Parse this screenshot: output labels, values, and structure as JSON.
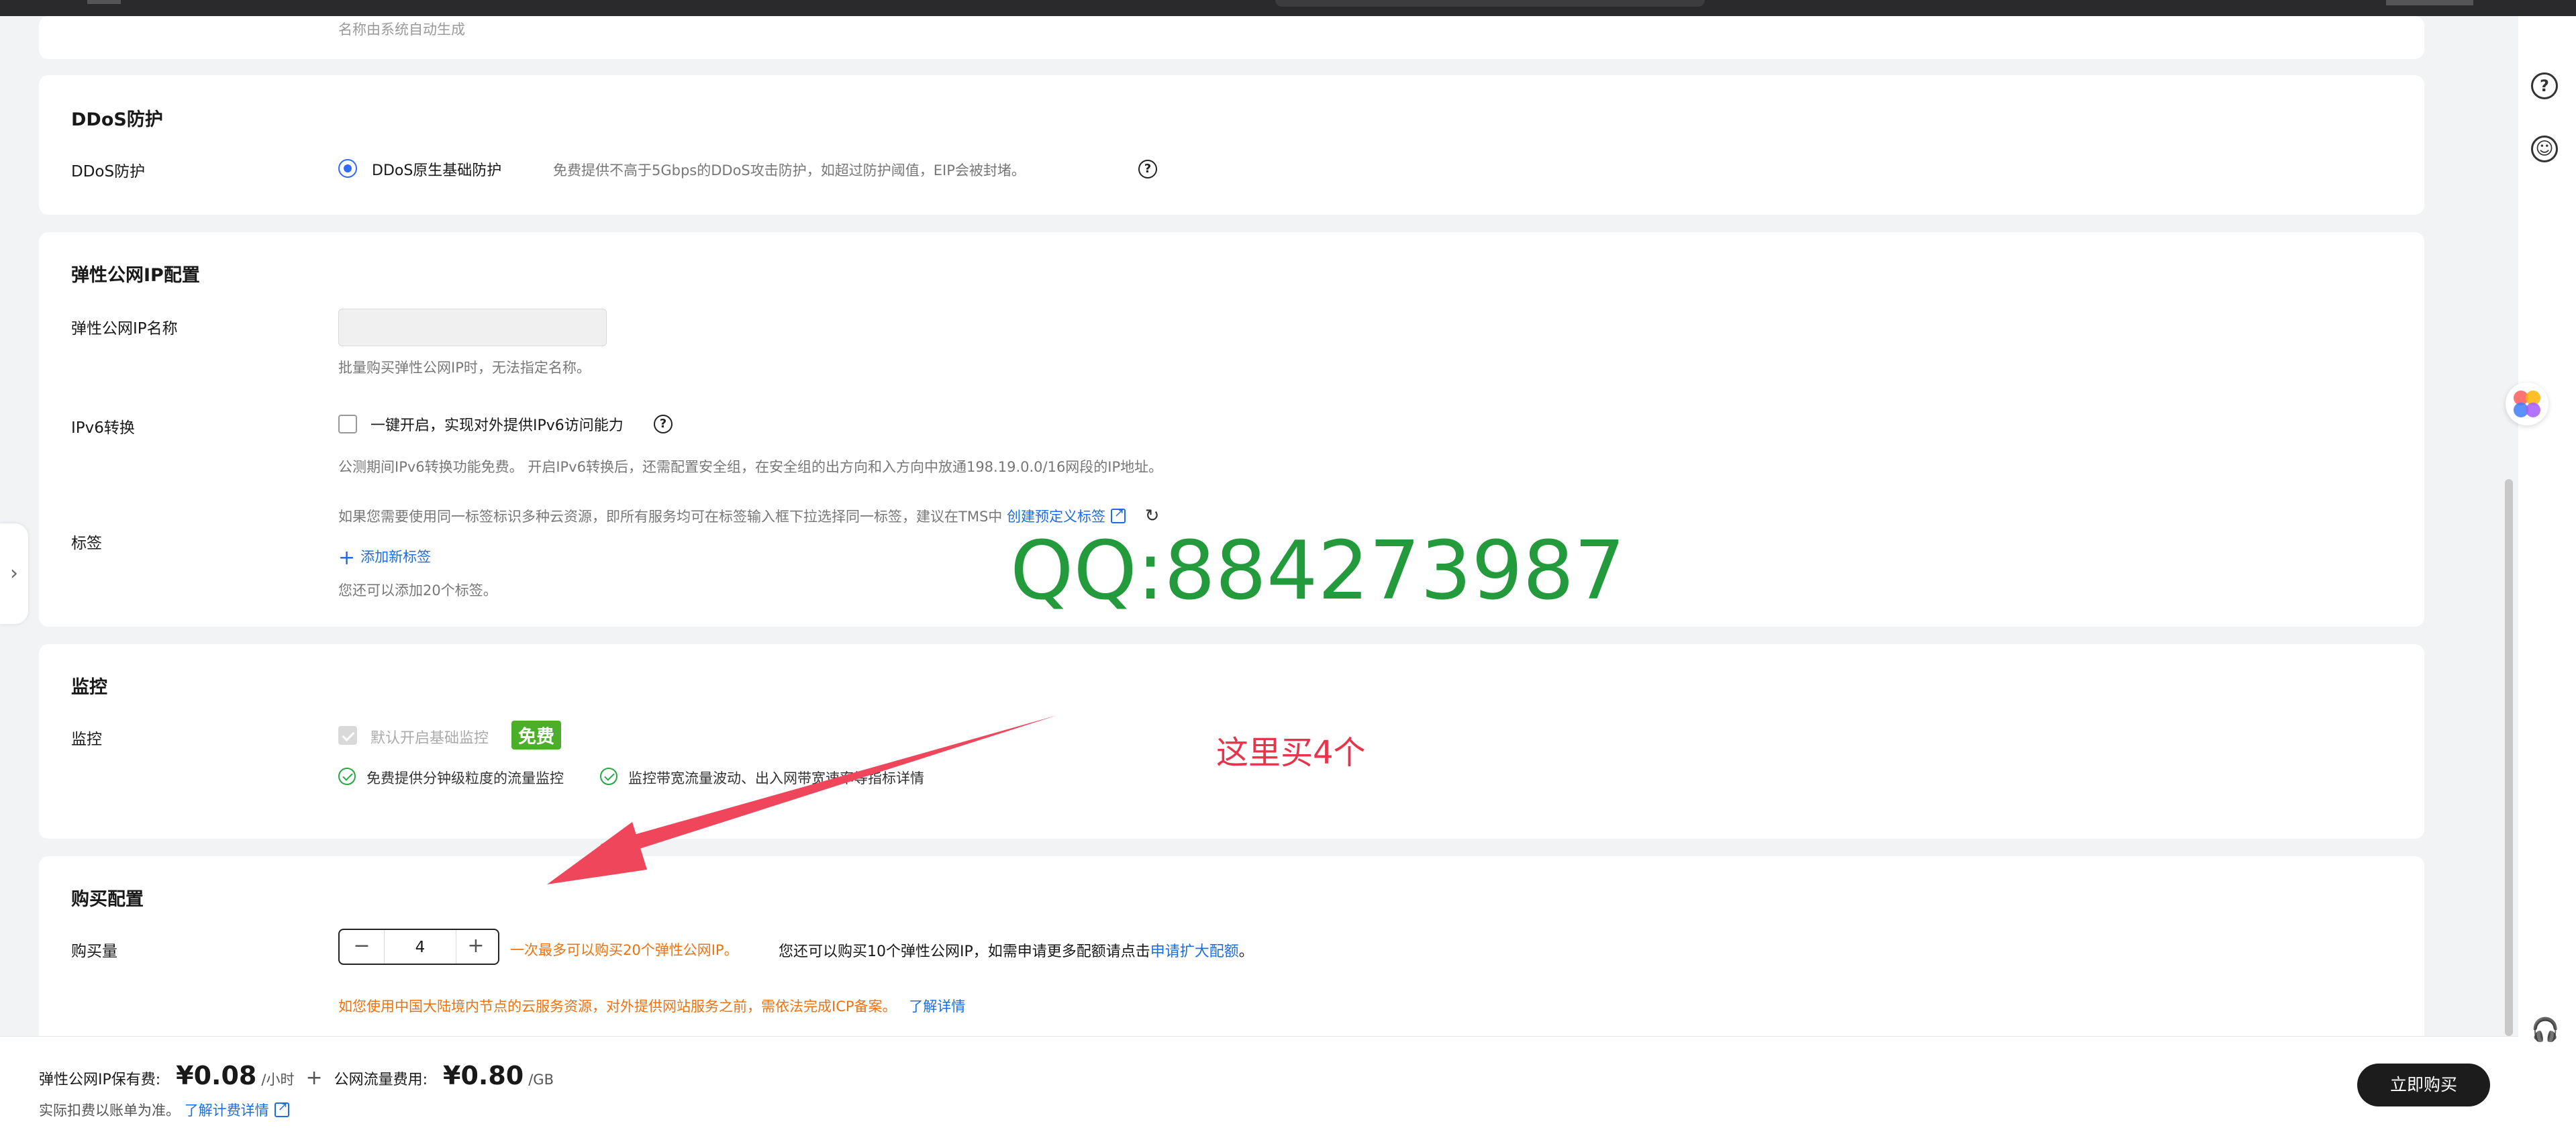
{
  "top_note": "名称由系统自动生成",
  "ddos": {
    "title": "DDoS防护",
    "label": "DDoS防护",
    "option": "DDoS原生基础防护",
    "desc": "免费提供不高于5Gbps的DDoS攻击防护，如超过防护阈值，EIP会被封堵。"
  },
  "eip": {
    "title": "弹性公网IP配置",
    "name_label": "弹性公网IP名称",
    "name_value": "",
    "name_hint": "批量购买弹性公网IP时，无法指定名称。",
    "ipv6_label": "IPv6转换",
    "ipv6_option": "一键开启，实现对外提供IPv6访问能力",
    "ipv6_hint": "公测期间IPv6转换功能免费。 开启IPv6转换后，还需配置安全组，在安全组的出方向和入方向中放通198.19.0.0/16网段的IP地址。",
    "tag_label": "标签",
    "tag_desc": "如果您需要使用同一标签标识多种云资源，即所有服务均可在标签输入框下拉选择同一标签，建议在TMS中",
    "tag_link": "创建预定义标签",
    "add_tag": "添加新标签",
    "tag_remaining": "您还可以添加20个标签。"
  },
  "monitor": {
    "title": "监控",
    "label": "监控",
    "option": "默认开启基础监控",
    "badge": "免费",
    "feature1": "免费提供分钟级粒度的流量监控",
    "feature2": "监控带宽流量波动、出入网带宽速率等指标详情"
  },
  "purchase": {
    "title": "购买配置",
    "qty_label": "购买量",
    "qty_value": "4",
    "limit_note": "一次最多可以购买20个弹性公网IP。",
    "quota_note": "您还可以购买10个弹性公网IP，如需申请更多配额请点击",
    "quota_link": "申请扩大配额",
    "period": "。",
    "icp_note": "如您使用中国大陆境内节点的云服务资源，对外提供网站服务之前，需依法完成ICP备案。",
    "icp_link": "了解详情"
  },
  "overlay": {
    "watermark": "QQ:884273987",
    "annotation": "这里买4个"
  },
  "footer": {
    "eip_fee_label": "弹性公网IP保有费:",
    "eip_fee": "¥0.08",
    "eip_fee_unit": "/小时",
    "plus": "+",
    "traffic_fee_label": "公网流量费用:",
    "traffic_fee": "¥0.80",
    "traffic_fee_unit": "/GB",
    "billing_note": "实际扣费以账单为准。",
    "billing_link": "了解计费详情",
    "buy_button": "立即购买"
  },
  "colors": {
    "accent": "#1c6ee0",
    "warning": "#f0720f",
    "success": "#28a745",
    "badge": "#4caf2a",
    "watermark": "#239a3c",
    "annotation": "#e8344a"
  }
}
